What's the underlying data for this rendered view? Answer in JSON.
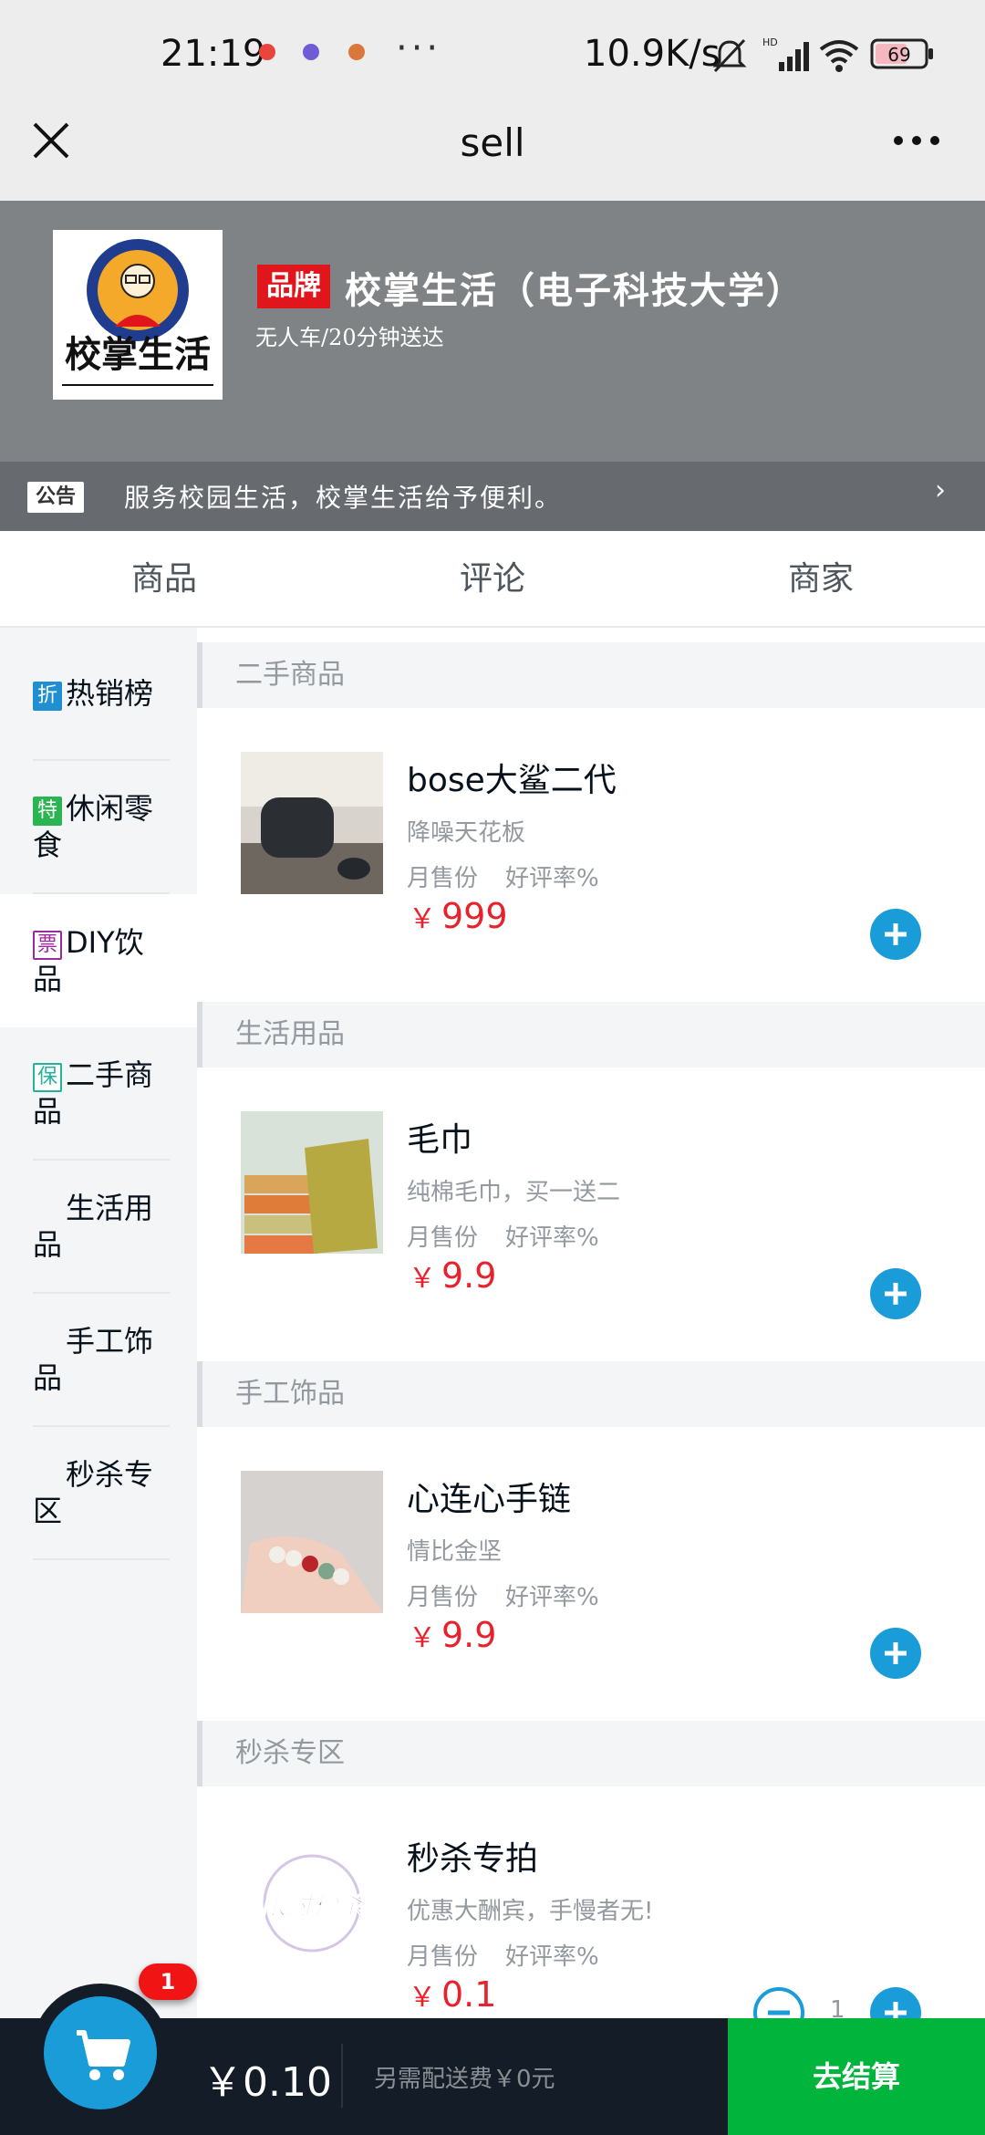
{
  "status_bar": {
    "time": "21:19",
    "dots": "···",
    "net_speed": "10.9K/s",
    "battery": "69",
    "network": "HD"
  },
  "title_bar": {
    "title": "sell"
  },
  "header": {
    "logo_text": "校掌生活",
    "brand_badge": "品牌",
    "shop_name": "校掌生活（电子科技大学）",
    "description": "无人车/20分钟送达",
    "notice_badge": "公告",
    "notice_text": "服务校园生活，校掌生活给予便利。",
    "notice_arrow": "›"
  },
  "tabs": [
    "商品",
    "评论",
    "商家"
  ],
  "menu": [
    {
      "badge": "折",
      "label": "热销榜"
    },
    {
      "badge": "特",
      "label": "休闲零食"
    },
    {
      "badge": "票",
      "label": "DIY饮品"
    },
    {
      "badge": "保",
      "label": "二手商品"
    },
    {
      "badge": "",
      "label": "生活用品"
    },
    {
      "badge": "",
      "label": "手工饰品"
    },
    {
      "badge": "",
      "label": "秒杀专区"
    }
  ],
  "sections": [
    {
      "title": "二手商品",
      "food": {
        "name": "bose大鲨二代",
        "desc": "降噪天花板",
        "sell": "月售份",
        "rating": "好评率%",
        "currency": "￥",
        "price": "999"
      }
    },
    {
      "title": "生活用品",
      "food": {
        "name": "毛巾",
        "desc": "纯棉毛巾，买一送二",
        "sell": "月售份",
        "rating": "好评率%",
        "currency": "￥",
        "price": "9.9"
      }
    },
    {
      "title": "手工饰品",
      "food": {
        "name": "心连心手链",
        "desc": "情比金坚",
        "sell": "月售份",
        "rating": "好评率%",
        "currency": "￥",
        "price": "9.9"
      }
    },
    {
      "title": "秒杀专区",
      "food": {
        "name": "秒杀专拍",
        "desc": "优惠大酬宾，手慢者无!",
        "sell": "月售份",
        "rating": "好评率%",
        "currency": "￥",
        "price": "0.1",
        "count": "1",
        "img_text": "限时秒杀"
      }
    }
  ],
  "shopcart": {
    "count": "1",
    "total": "￥0.10",
    "delivery": "另需配送费￥0元",
    "checkout": "去结算"
  },
  "colors": {
    "accent": "#1a9cd8",
    "price": "#e8222d",
    "checkout": "#00b43c",
    "cart_bar": "#141d27",
    "brand": "#e0161c"
  }
}
